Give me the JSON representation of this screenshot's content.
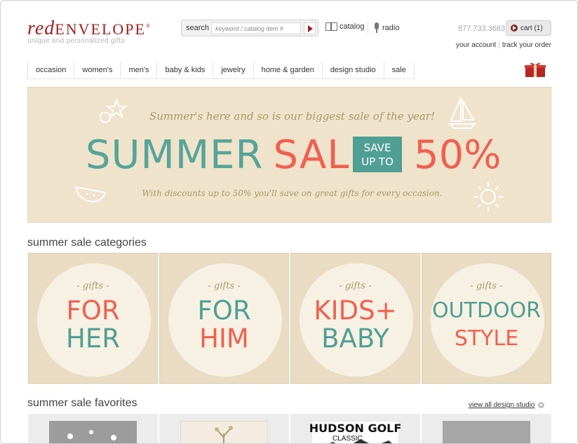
{
  "brand": {
    "name_part1": "red",
    "name_part2": "ENVELOPE",
    "mark": "®",
    "tagline": "unique and personalized gifts"
  },
  "search": {
    "label": "search",
    "placeholder": "keyword / catalog item #"
  },
  "header_links": {
    "catalog": "catalog",
    "radio": "radio",
    "phone": "877.733.3683",
    "cart": "cart (1)",
    "your_account": "your account",
    "separator": "|",
    "track_order": "track your order"
  },
  "nav": {
    "items": [
      "occasion",
      "women's",
      "men's",
      "baby & kids",
      "jewelry",
      "home & garden",
      "design studio",
      "sale"
    ]
  },
  "hero": {
    "subtitle": "Summer's here and so is our biggest sale of the year!",
    "word1": "SUMMER",
    "word2": "SALE",
    "save_line1": "SAVE",
    "save_line2": "UP TO",
    "percent": "50%",
    "tagline": "With discounts up to 50% you'll save on great gifts for every occasion."
  },
  "categories": {
    "title": "summer sale categories",
    "items": [
      {
        "prefix": "- gifts -",
        "line1": "FOR",
        "line2": "HER"
      },
      {
        "prefix": "- gifts -",
        "line1": "FOR",
        "line2": "HIM"
      },
      {
        "prefix": "- gifts -",
        "line1": "KIDS+",
        "line2": "BABY"
      },
      {
        "prefix": "- gifts -",
        "line1": "OUTDOOR",
        "line2": "STYLE"
      }
    ]
  },
  "favorites": {
    "title": "summer sale favorites",
    "view_all": "view all design studio",
    "product3_line1": "HUDSON GOLF",
    "product3_line2": "CLASSIC"
  },
  "colors": {
    "brand_red": "#a31f1f",
    "teal": "#4f9f95",
    "coral": "#f0604e",
    "sand": "#efe3cb"
  }
}
